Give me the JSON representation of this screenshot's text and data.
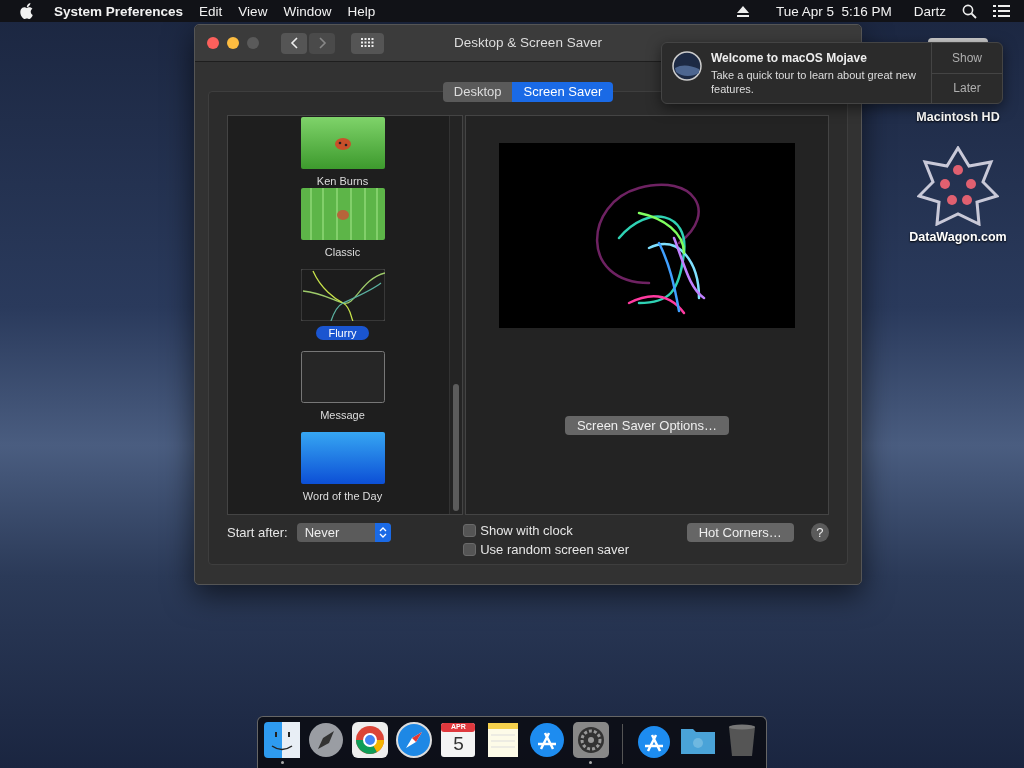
{
  "menu_bar": {
    "app_name": "System Preferences",
    "menus": [
      "Edit",
      "View",
      "Window",
      "Help"
    ],
    "clock": "Tue Apr 5  5:16 PM",
    "user": "Dartz"
  },
  "window": {
    "title": "Desktop & Screen Saver",
    "tabs": [
      {
        "label": "Desktop",
        "selected": false
      },
      {
        "label": "Screen Saver",
        "selected": true
      }
    ],
    "screen_savers": [
      {
        "name": "Ken Burns",
        "kind": "ladybug",
        "selected": false
      },
      {
        "name": "Classic",
        "kind": "grass",
        "selected": false
      },
      {
        "name": "Flurry",
        "kind": "flurry",
        "selected": true
      },
      {
        "name": "Message",
        "kind": "message",
        "selected": false
      },
      {
        "name": "Word of the Day",
        "kind": "words",
        "selected": false
      }
    ],
    "options_button": "Screen Saver Options…",
    "start_after": {
      "label": "Start after:",
      "value": "Never"
    },
    "checkboxes": [
      {
        "label": "Show with clock",
        "checked": false
      },
      {
        "label": "Use random screen saver",
        "checked": false
      }
    ],
    "hot_corners_button": "Hot Corners…",
    "help_button": "?"
  },
  "notification": {
    "title": "Welcome to macOS Mojave",
    "body": "Take a quick tour to learn about great new features.",
    "actions": [
      "Show",
      "Later"
    ]
  },
  "desktop_icons": [
    {
      "label": "Macintosh HD",
      "kind": "drive"
    },
    {
      "label": "DataWagon.com",
      "kind": "emblem"
    }
  ],
  "dock": {
    "apps": [
      {
        "kind": "finder",
        "running": true
      },
      {
        "kind": "launchpad",
        "running": false
      },
      {
        "kind": "chrome",
        "running": false
      },
      {
        "kind": "safari",
        "running": false
      },
      {
        "kind": "calendar",
        "month": "APR",
        "day": "5",
        "running": false
      },
      {
        "kind": "notes",
        "running": false
      },
      {
        "kind": "appstore",
        "running": false
      },
      {
        "kind": "settings",
        "running": true
      }
    ],
    "others": [
      {
        "kind": "downloads"
      },
      {
        "kind": "folder"
      },
      {
        "kind": "trash"
      }
    ]
  }
}
